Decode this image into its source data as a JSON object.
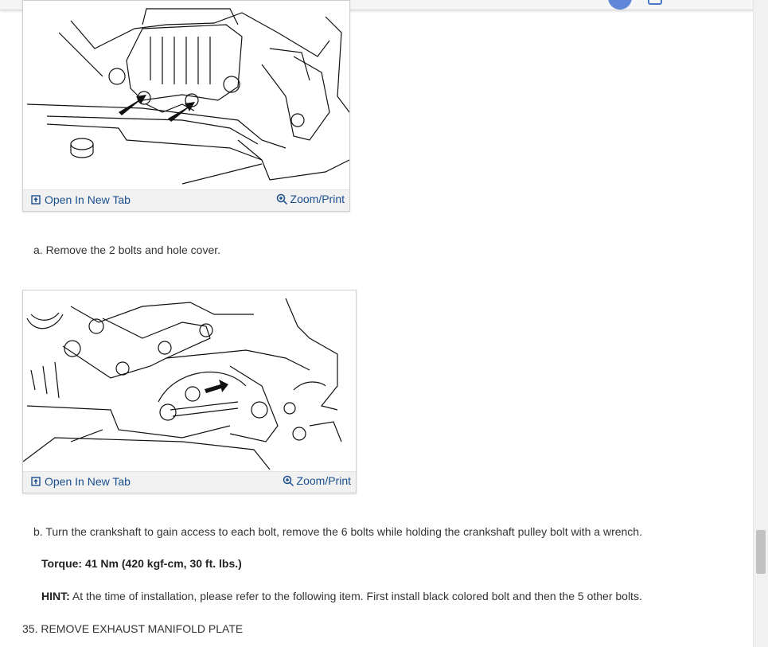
{
  "figures": [
    {
      "open_label": "Open In New Tab",
      "zoom_label": "Zoom/Print"
    },
    {
      "open_label": "Open In New Tab",
      "zoom_label": "Zoom/Print"
    }
  ],
  "steps": {
    "a": "a. Remove the 2 bolts and hole cover.",
    "b": "b. Turn the crankshaft to gain access to each bolt, remove the 6 bolts while holding the crankshaft pulley bolt with a wrench.",
    "torque_label": "Torque:",
    "torque_value": " 41 Nm (420 kgf-cm, 30 ft. lbs.)",
    "hint_label": "HINT:",
    "hint_value": " At the time of installation, please refer to the following item. First install black colored bolt and then the 5 other bolts.",
    "step35": "35. REMOVE EXHAUST MANIFOLD PLATE"
  },
  "icons": {
    "open": "open-new-tab-icon",
    "zoom": "zoom-in-icon"
  },
  "colors": {
    "link": "#1a4f8f",
    "text": "#333333",
    "bar": "#f1f1f1"
  }
}
